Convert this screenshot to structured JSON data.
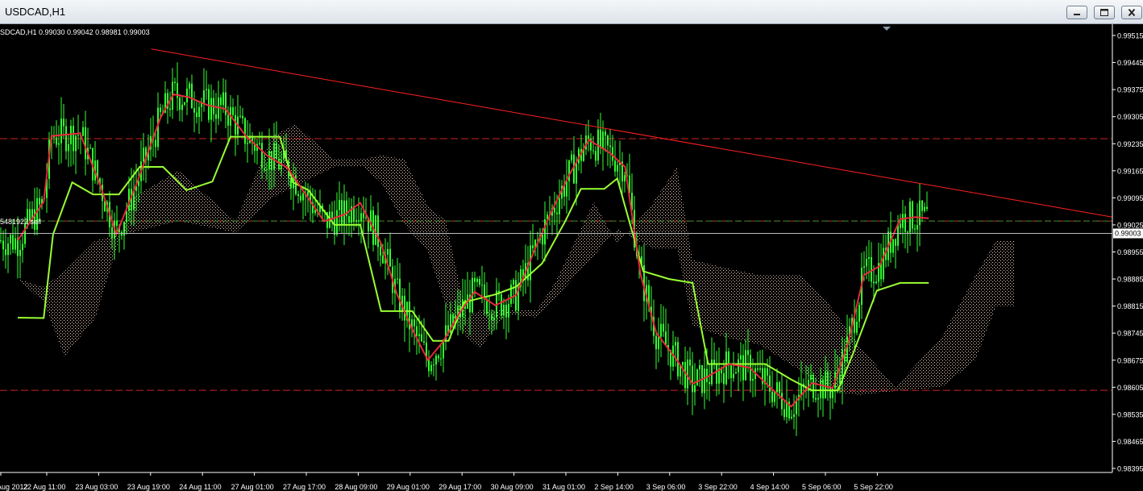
{
  "window": {
    "title": "USDCAD,H1",
    "buttons": {
      "minimize": "minimize-icon",
      "maximize": "maximize-icon",
      "close": "close-icon"
    }
  },
  "chart_info": "SDCAD,H1  0.99030 0.99042 0.98981 0.99003",
  "order_label": "5481922 sell",
  "current_price": "0.99003",
  "colors": {
    "background": "#000000",
    "candles": "#33ff33",
    "tenkan": "#e8283c",
    "kijun": "#99ff33",
    "cloud": "#e8c8b8",
    "trendline": "#ff2020",
    "hlines": "#cc2222",
    "order_line": "#2e8b2e",
    "price_line": "#bbbbbb"
  },
  "chart_data": {
    "type": "candlestick",
    "symbol": "USDCAD",
    "timeframe": "H1",
    "ohlc_shown": {
      "open": 0.9903,
      "high": 0.99042,
      "low": 0.98981,
      "close": 0.99003
    },
    "ylim": [
      0.98395,
      0.99515
    ],
    "y_ticks": [
      "0.99515",
      "0.99445",
      "0.99375",
      "0.99305",
      "0.99235",
      "0.99165",
      "0.99095",
      "0.99025",
      "0.98955",
      "0.98885",
      "0.98815",
      "0.98745",
      "0.98675",
      "0.98605",
      "0.98535",
      "0.98465",
      "0.98395"
    ],
    "x_ticks": [
      "Aug 2012",
      "22 Aug 11:00",
      "23 Aug 03:00",
      "23 Aug 19:00",
      "24 Aug 11:00",
      "27 Aug 01:00",
      "27 Aug 17:00",
      "28 Aug 09:00",
      "29 Aug 01:00",
      "29 Aug 17:00",
      "30 Aug 09:00",
      "31 Aug 01:00",
      "2 Sep 14:00",
      "3 Sep 06:00",
      "3 Sep 22:00",
      "4 Sep 14:00",
      "5 Sep 06:00",
      "5 Sep 22:00"
    ],
    "horizontal_levels": [
      0.99248,
      0.99035,
      0.98597
    ],
    "trendline": {
      "start": {
        "time_index": 2.57,
        "price": 0.9948
      },
      "end": {
        "time_index": 21.1,
        "price": 0.99045
      }
    },
    "tenkan_path": [
      [
        0.0,
        0.98985
      ],
      [
        0.5,
        0.99085
      ],
      [
        0.65,
        0.99255
      ],
      [
        1.2,
        0.99262
      ],
      [
        1.6,
        0.99124
      ],
      [
        1.9,
        0.99
      ],
      [
        2.3,
        0.99135
      ],
      [
        2.75,
        0.99302
      ],
      [
        3.0,
        0.99363
      ],
      [
        3.3,
        0.99355
      ],
      [
        3.65,
        0.99335
      ],
      [
        4.0,
        0.99325
      ],
      [
        4.4,
        0.99254
      ],
      [
        4.8,
        0.99205
      ],
      [
        5.2,
        0.99172
      ],
      [
        5.6,
        0.99094
      ],
      [
        5.9,
        0.99034
      ],
      [
        6.3,
        0.99052
      ],
      [
        6.6,
        0.99082
      ],
      [
        7.0,
        0.98977
      ],
      [
        7.3,
        0.98848
      ],
      [
        7.6,
        0.98755
      ],
      [
        7.9,
        0.98675
      ],
      [
        8.2,
        0.98724
      ],
      [
        8.5,
        0.98795
      ],
      [
        8.8,
        0.98852
      ],
      [
        9.2,
        0.98817
      ],
      [
        9.6,
        0.98843
      ],
      [
        10.0,
        0.98974
      ],
      [
        10.3,
        0.99064
      ],
      [
        10.6,
        0.99148
      ],
      [
        11.0,
        0.99245
      ],
      [
        11.4,
        0.99212
      ],
      [
        11.7,
        0.99175
      ],
      [
        12.0,
        0.98896
      ],
      [
        12.3,
        0.98746
      ],
      [
        12.7,
        0.98675
      ],
      [
        13.0,
        0.98614
      ],
      [
        13.3,
        0.98633
      ],
      [
        13.7,
        0.98665
      ],
      [
        14.1,
        0.98656
      ],
      [
        14.5,
        0.98604
      ],
      [
        14.9,
        0.98555
      ],
      [
        15.3,
        0.98616
      ],
      [
        15.7,
        0.98603
      ],
      [
        16.0,
        0.98721
      ],
      [
        16.3,
        0.98895
      ],
      [
        16.6,
        0.98918
      ],
      [
        17.0,
        0.9904
      ],
      [
        17.3,
        0.99045
      ],
      [
        17.55,
        0.99042
      ]
    ],
    "kijun_path": [
      [
        0.0,
        0.98785
      ],
      [
        0.5,
        0.98784
      ],
      [
        0.68,
        0.99
      ],
      [
        1.05,
        0.99135
      ],
      [
        1.45,
        0.99104
      ],
      [
        1.95,
        0.99104
      ],
      [
        2.35,
        0.99175
      ],
      [
        2.8,
        0.99175
      ],
      [
        3.25,
        0.99115
      ],
      [
        3.75,
        0.99137
      ],
      [
        4.1,
        0.99253
      ],
      [
        5.05,
        0.99253
      ],
      [
        5.3,
        0.99135
      ],
      [
        5.6,
        0.99115
      ],
      [
        6.1,
        0.99025
      ],
      [
        6.6,
        0.99025
      ],
      [
        7.0,
        0.98802
      ],
      [
        7.6,
        0.98802
      ],
      [
        8.0,
        0.98725
      ],
      [
        8.3,
        0.98725
      ],
      [
        8.6,
        0.98825
      ],
      [
        9.2,
        0.98845
      ],
      [
        9.6,
        0.98865
      ],
      [
        10.1,
        0.98925
      ],
      [
        10.55,
        0.99035
      ],
      [
        10.85,
        0.99118
      ],
      [
        11.3,
        0.99118
      ],
      [
        11.55,
        0.99145
      ],
      [
        12.05,
        0.98905
      ],
      [
        12.55,
        0.98885
      ],
      [
        13.0,
        0.98875
      ],
      [
        13.3,
        0.98665
      ],
      [
        14.4,
        0.98665
      ],
      [
        14.9,
        0.98625
      ],
      [
        15.3,
        0.98597
      ],
      [
        15.8,
        0.98597
      ],
      [
        16.1,
        0.98695
      ],
      [
        16.55,
        0.98855
      ],
      [
        17.0,
        0.98875
      ],
      [
        17.55,
        0.98875
      ]
    ],
    "cloud": {
      "top": [
        [
          0.0,
          0.98885
        ],
        [
          0.5,
          0.98825
        ],
        [
          0.9,
          0.98685
        ],
        [
          1.5,
          0.98785
        ],
        [
          2.2,
          0.99095
        ],
        [
          3.1,
          0.99165
        ],
        [
          4.2,
          0.99035
        ],
        [
          4.9,
          0.99255
        ],
        [
          5.35,
          0.99285
        ],
        [
          6.1,
          0.99195
        ],
        [
          6.65,
          0.99195
        ],
        [
          7.0,
          0.99205
        ],
        [
          7.45,
          0.99195
        ],
        [
          7.9,
          0.99075
        ],
        [
          8.25,
          0.99035
        ],
        [
          8.65,
          0.98785
        ],
        [
          8.9,
          0.98805
        ],
        [
          9.4,
          0.98805
        ],
        [
          10.0,
          0.98805
        ],
        [
          10.35,
          0.98875
        ],
        [
          11.1,
          0.99085
        ],
        [
          11.55,
          0.98975
        ],
        [
          12.2,
          0.99075
        ],
        [
          12.7,
          0.99175
        ],
        [
          13.0,
          0.98935
        ],
        [
          13.6,
          0.98915
        ],
        [
          14.3,
          0.98895
        ],
        [
          15.1,
          0.98895
        ],
        [
          15.6,
          0.98825
        ],
        [
          16.2,
          0.98715
        ],
        [
          16.9,
          0.98605
        ],
        [
          17.8,
          0.98735
        ],
        [
          18.45,
          0.98895
        ],
        [
          18.85,
          0.98985
        ],
        [
          19.2,
          0.98985
        ]
      ],
      "bottom": [
        [
          0.0,
          0.98885
        ],
        [
          0.5,
          0.98865
        ],
        [
          0.9,
          0.98905
        ],
        [
          1.5,
          0.98985
        ],
        [
          2.2,
          0.99005
        ],
        [
          3.1,
          0.99035
        ],
        [
          4.2,
          0.99005
        ],
        [
          4.9,
          0.99095
        ],
        [
          5.35,
          0.99125
        ],
        [
          6.1,
          0.99175
        ],
        [
          6.65,
          0.99175
        ],
        [
          7.0,
          0.99135
        ],
        [
          7.45,
          0.99025
        ],
        [
          7.9,
          0.98955
        ],
        [
          8.25,
          0.98815
        ],
        [
          8.65,
          0.98735
        ],
        [
          8.9,
          0.98705
        ],
        [
          9.4,
          0.98795
        ],
        [
          10.0,
          0.98785
        ],
        [
          10.35,
          0.98835
        ],
        [
          11.1,
          0.98945
        ],
        [
          11.55,
          0.99015
        ],
        [
          12.2,
          0.98965
        ],
        [
          12.7,
          0.98965
        ],
        [
          13.0,
          0.98765
        ],
        [
          13.6,
          0.98735
        ],
        [
          14.3,
          0.98715
        ],
        [
          15.1,
          0.98645
        ],
        [
          15.6,
          0.98595
        ],
        [
          16.2,
          0.98585
        ],
        [
          16.9,
          0.98595
        ],
        [
          17.8,
          0.98605
        ],
        [
          18.45,
          0.98675
        ],
        [
          18.85,
          0.98815
        ],
        [
          19.2,
          0.98815
        ]
      ]
    },
    "grid": false,
    "legend": "none"
  }
}
